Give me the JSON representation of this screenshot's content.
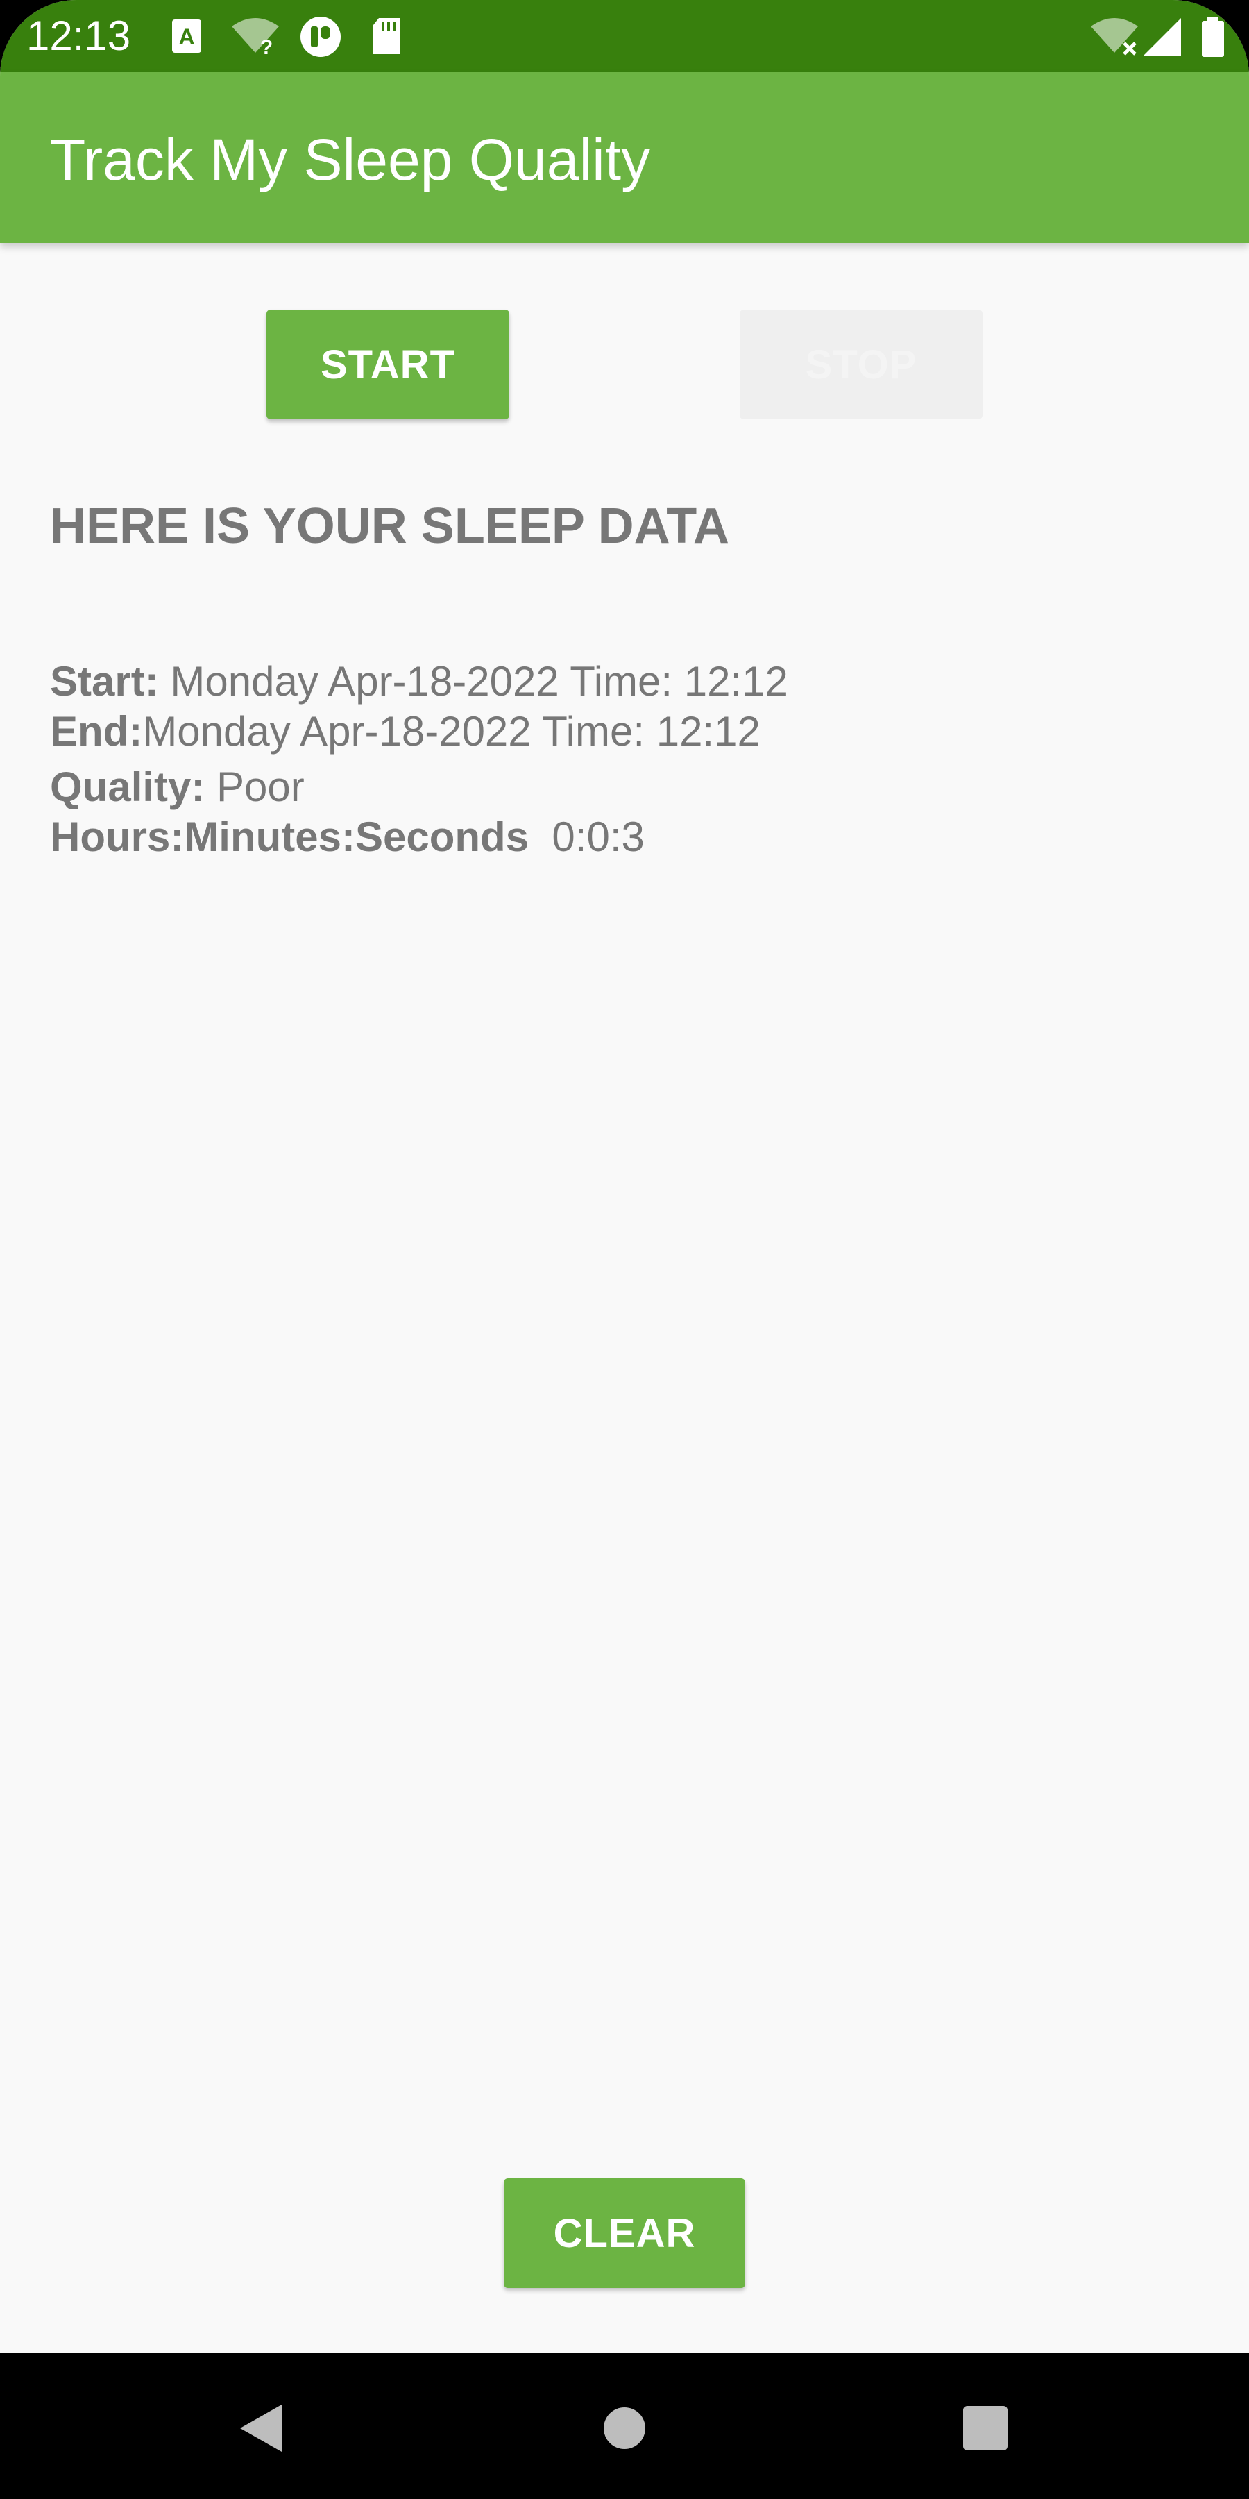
{
  "status_bar": {
    "time": "12:13",
    "background_color": "#38800D",
    "icons_left": [
      "a-notification-icon",
      "wifi-question-icon",
      "circle-app-icon",
      "sd-card-icon"
    ],
    "icons_right": [
      "wifi-off-icon",
      "cellular-signal-icon",
      "battery-icon"
    ]
  },
  "app_bar": {
    "title": "Track My Sleep Quality",
    "background_color": "#6CB443"
  },
  "controls": {
    "start_label": "START",
    "stop_label": "STOP",
    "stop_enabled": false,
    "clear_label": "CLEAR"
  },
  "content": {
    "heading": "HERE IS YOUR SLEEP DATA",
    "start_label": "Start:",
    "start_value": "Monday Apr-18-2022 Time: 12:12",
    "end_label": "End:",
    "end_value": "Monday Apr-18-2022 Time: 12:12",
    "quality_label": "Quality:",
    "quality_value": "Poor",
    "duration_label": "Hours:Minutes:Seconds",
    "duration_value": "0:0:3"
  },
  "nav_bar": {
    "buttons": [
      "back-icon",
      "home-icon",
      "recents-icon"
    ]
  }
}
